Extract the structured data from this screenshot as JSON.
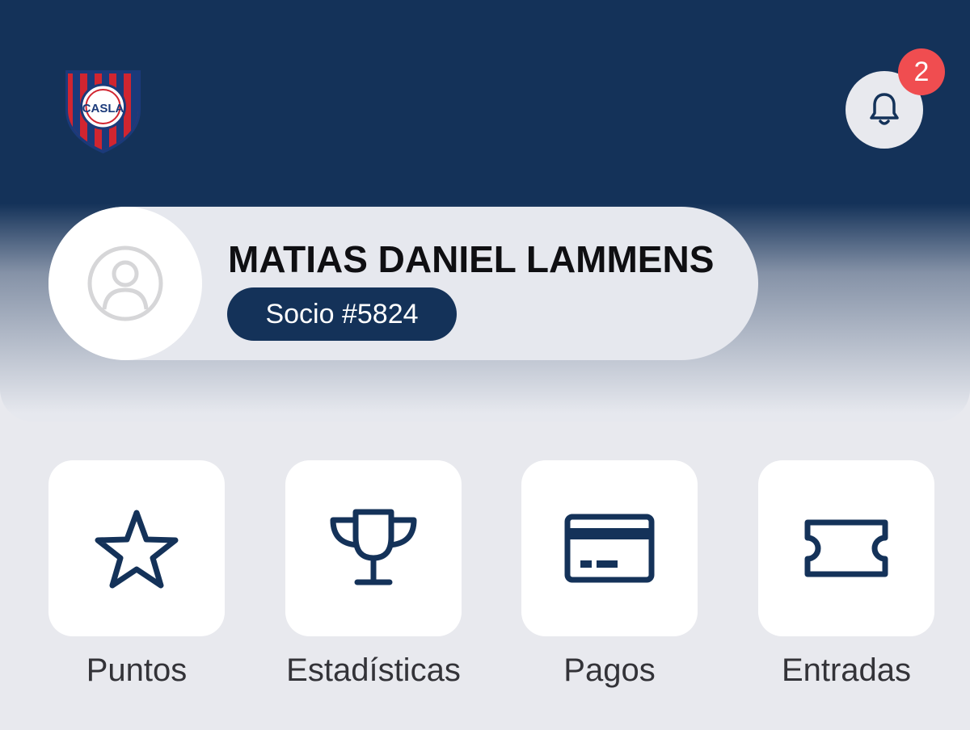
{
  "header": {
    "logo_icon": "club-crest-icon",
    "logo_text": "CASLA",
    "notifications": {
      "icon": "bell-icon",
      "count": "2"
    }
  },
  "profile": {
    "avatar_icon": "user-avatar-icon",
    "name": "MATIAS DANIEL LAMMENS",
    "member_id": "Socio #5824"
  },
  "quick_actions": [
    {
      "label": "Puntos",
      "icon": "star-icon"
    },
    {
      "label": "Estadísticas",
      "icon": "trophy-icon"
    },
    {
      "label": "Pagos",
      "icon": "credit-card-icon"
    },
    {
      "label": "Entradas",
      "icon": "ticket-icon"
    }
  ],
  "colors": {
    "primary_navy": "#143259",
    "badge_red": "#f04d50",
    "background": "#e8e9ee",
    "crest_red": "#d12530",
    "crest_blue": "#1b3a7a"
  }
}
